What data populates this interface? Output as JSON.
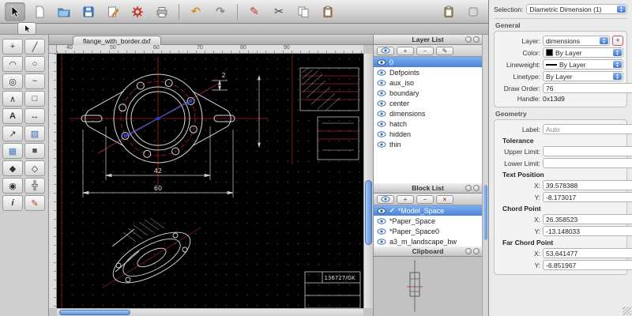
{
  "icons": {
    "stepper_up": "▲",
    "stepper_down": "▼",
    "plus": "+",
    "minus": "−",
    "pencil": "✎",
    "close": "×",
    "check": "✓"
  },
  "toolbar": {
    "tools": [
      {
        "name": "pointer-tool"
      },
      {
        "name": "new-document"
      },
      {
        "name": "open-file"
      },
      {
        "name": "save-file"
      },
      {
        "name": "edit-drawing-preferences"
      },
      {
        "name": "application-preferences"
      },
      {
        "name": "print"
      },
      {
        "name": "undo",
        "glyph": "↶"
      },
      {
        "name": "redo",
        "glyph": "↷"
      },
      {
        "name": "draw-pen",
        "glyph": "✎"
      },
      {
        "name": "cut",
        "glyph": "✂"
      },
      {
        "name": "copy"
      },
      {
        "name": "paste"
      },
      {
        "name": "clipboard-tool"
      },
      {
        "name": "overflow-tool"
      }
    ]
  },
  "tool_palette": {
    "tools": [
      {
        "name": "point-tool",
        "glyph": "+"
      },
      {
        "name": "line-tool",
        "glyph": "╱"
      },
      {
        "name": "arc-tool",
        "glyph": "◠"
      },
      {
        "name": "circle-tool",
        "glyph": "○"
      },
      {
        "name": "ellipse-tool",
        "glyph": "◎"
      },
      {
        "name": "spline-tool",
        "glyph": "~"
      },
      {
        "name": "polyline-tool",
        "glyph": "∧"
      },
      {
        "name": "rectangle-tool",
        "glyph": "□"
      },
      {
        "name": "text-tool",
        "glyph": "A"
      },
      {
        "name": "dimension-tool",
        "glyph": "↔"
      },
      {
        "name": "leader-tool",
        "glyph": "↗"
      },
      {
        "name": "hatch-tool",
        "glyph": "▨"
      },
      {
        "name": "image-tool",
        "glyph": "▦"
      },
      {
        "name": "solid-fill-tool",
        "glyph": "■"
      },
      {
        "name": "block-tool",
        "glyph": "◆"
      },
      {
        "name": "box-3d-tool",
        "glyph": "◇"
      },
      {
        "name": "zoom-tool",
        "glyph": "◉"
      },
      {
        "name": "pan-tool",
        "glyph": "╬"
      },
      {
        "name": "info-tool",
        "glyph": "i"
      },
      {
        "name": "modify-tool",
        "glyph": "✎"
      }
    ]
  },
  "document": {
    "tab_title": "flange_with_border.dxf",
    "ruler_numbers": [
      "40",
      "50",
      "60",
      "70",
      "80",
      "90"
    ]
  },
  "drawing": {
    "dim_width": "42",
    "dim_total_width": "60",
    "dim_thickness": "2",
    "title_block_code": "136727/GK"
  },
  "layer_panel": {
    "title": "Layer List",
    "layers": [
      {
        "name": "0",
        "selected": true
      },
      {
        "name": "Defpoints"
      },
      {
        "name": "aux_iso"
      },
      {
        "name": "boundary"
      },
      {
        "name": "center"
      },
      {
        "name": "dimensions"
      },
      {
        "name": "hatch"
      },
      {
        "name": "hidden"
      },
      {
        "name": "thin"
      }
    ]
  },
  "block_panel": {
    "title": "Block List",
    "blocks": [
      {
        "name": "*Model_Space",
        "selected": true
      },
      {
        "name": "*Paper_Space"
      },
      {
        "name": "*Paper_Space0"
      },
      {
        "name": "a3_m_landscape_bw"
      }
    ]
  },
  "clipboard_panel": {
    "title": "Clipboard"
  },
  "properties": {
    "selection_label": "Selection:",
    "selection_value": "Diametric Dimension (1)",
    "general": {
      "title": "General",
      "layer_label": "Layer:",
      "layer_value": "dimensions",
      "color_label": "Color:",
      "color_value": "By Layer",
      "lineweight_label": "Lineweight:",
      "lineweight_value": "By Layer",
      "linetype_label": "Linetype:",
      "linetype_value": "By Layer",
      "draw_order_label": "Draw Order:",
      "draw_order_value": "76",
      "handle_label": "Handle:",
      "handle_value": "0x13d9"
    },
    "geometry": {
      "title": "Geometry",
      "label_label": "Label:",
      "label_value": "Auto",
      "label_button_glyph": "↻",
      "tolerance_title": "Tolerance",
      "upper_limit_label": "Upper Limit:",
      "upper_limit_value": "",
      "lower_limit_label": "Lower Limit:",
      "lower_limit_value": "",
      "text_position_title": "Text Position",
      "text_x_label": "X:",
      "text_x": "39.578388",
      "text_y_label": "Y:",
      "text_y": "-8.173017",
      "chord_title": "Chord Point",
      "chord_x_label": "X:",
      "chord_x": "26.358523",
      "chord_y_label": "Y:",
      "chord_y": "-13.148033",
      "far_chord_title": "Far Chord Point",
      "far_x_label": "X:",
      "far_x": "53.641477",
      "far_y_label": "Y:",
      "far_y": "-6.851967"
    }
  },
  "colors": {
    "accent": "#3f76d2",
    "selection_blue": "#4a82d8",
    "canvas_background": "#000000",
    "centerline_red": "#b22222",
    "geometry_stroke": "#d8d8d8",
    "selected_entity_blue": "#2f5bd8"
  }
}
